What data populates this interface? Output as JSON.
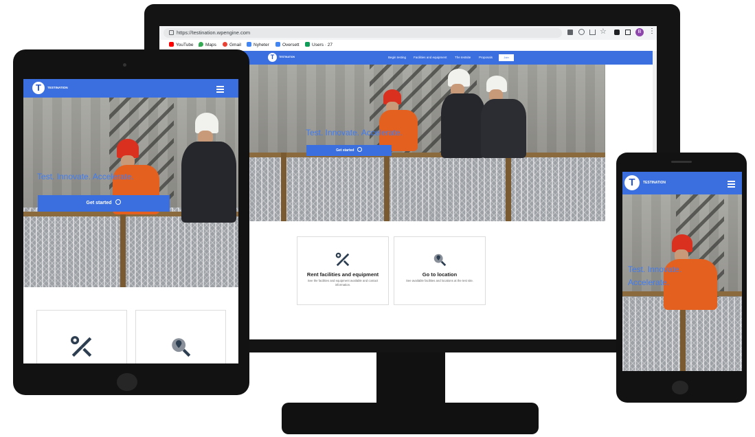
{
  "browser": {
    "url": "https://testination.wpengine.com",
    "profile_initial": "B",
    "bookmarks": [
      {
        "label": "YouTube",
        "color": "#ff0000"
      },
      {
        "label": "Maps",
        "color": "#34a853"
      },
      {
        "label": "Gmail",
        "color": "#ea4335"
      },
      {
        "label": "Nyheter",
        "color": "#4285f4"
      },
      {
        "label": "Oversett",
        "color": "#4285f4"
      },
      {
        "label": "Users · 27",
        "color": "#0f9d58"
      }
    ]
  },
  "site": {
    "brand": "TESTINATION",
    "brand_color": "#3b6fe0",
    "accent_text_color": "#3f7bf0",
    "nav": [
      "Begin testing",
      "Facilities and equipment",
      "The testsite",
      "Proposals"
    ],
    "nav_button": "Join",
    "hero_title": "Test. Innovate. Accelerate.",
    "cta_label": "Get started",
    "cards": [
      {
        "title": "Rent facilities and equipment",
        "desc": "See the facilities and equipment available and contact information.",
        "icon": "wrench-screwdriver-icon"
      },
      {
        "title": "Go to location",
        "desc": "See available facilities and locations at the test site.",
        "icon": "location-search-icon"
      }
    ]
  },
  "phone": {
    "hero_line1": "Test. Innovate.",
    "hero_line2": "Accelerate."
  }
}
